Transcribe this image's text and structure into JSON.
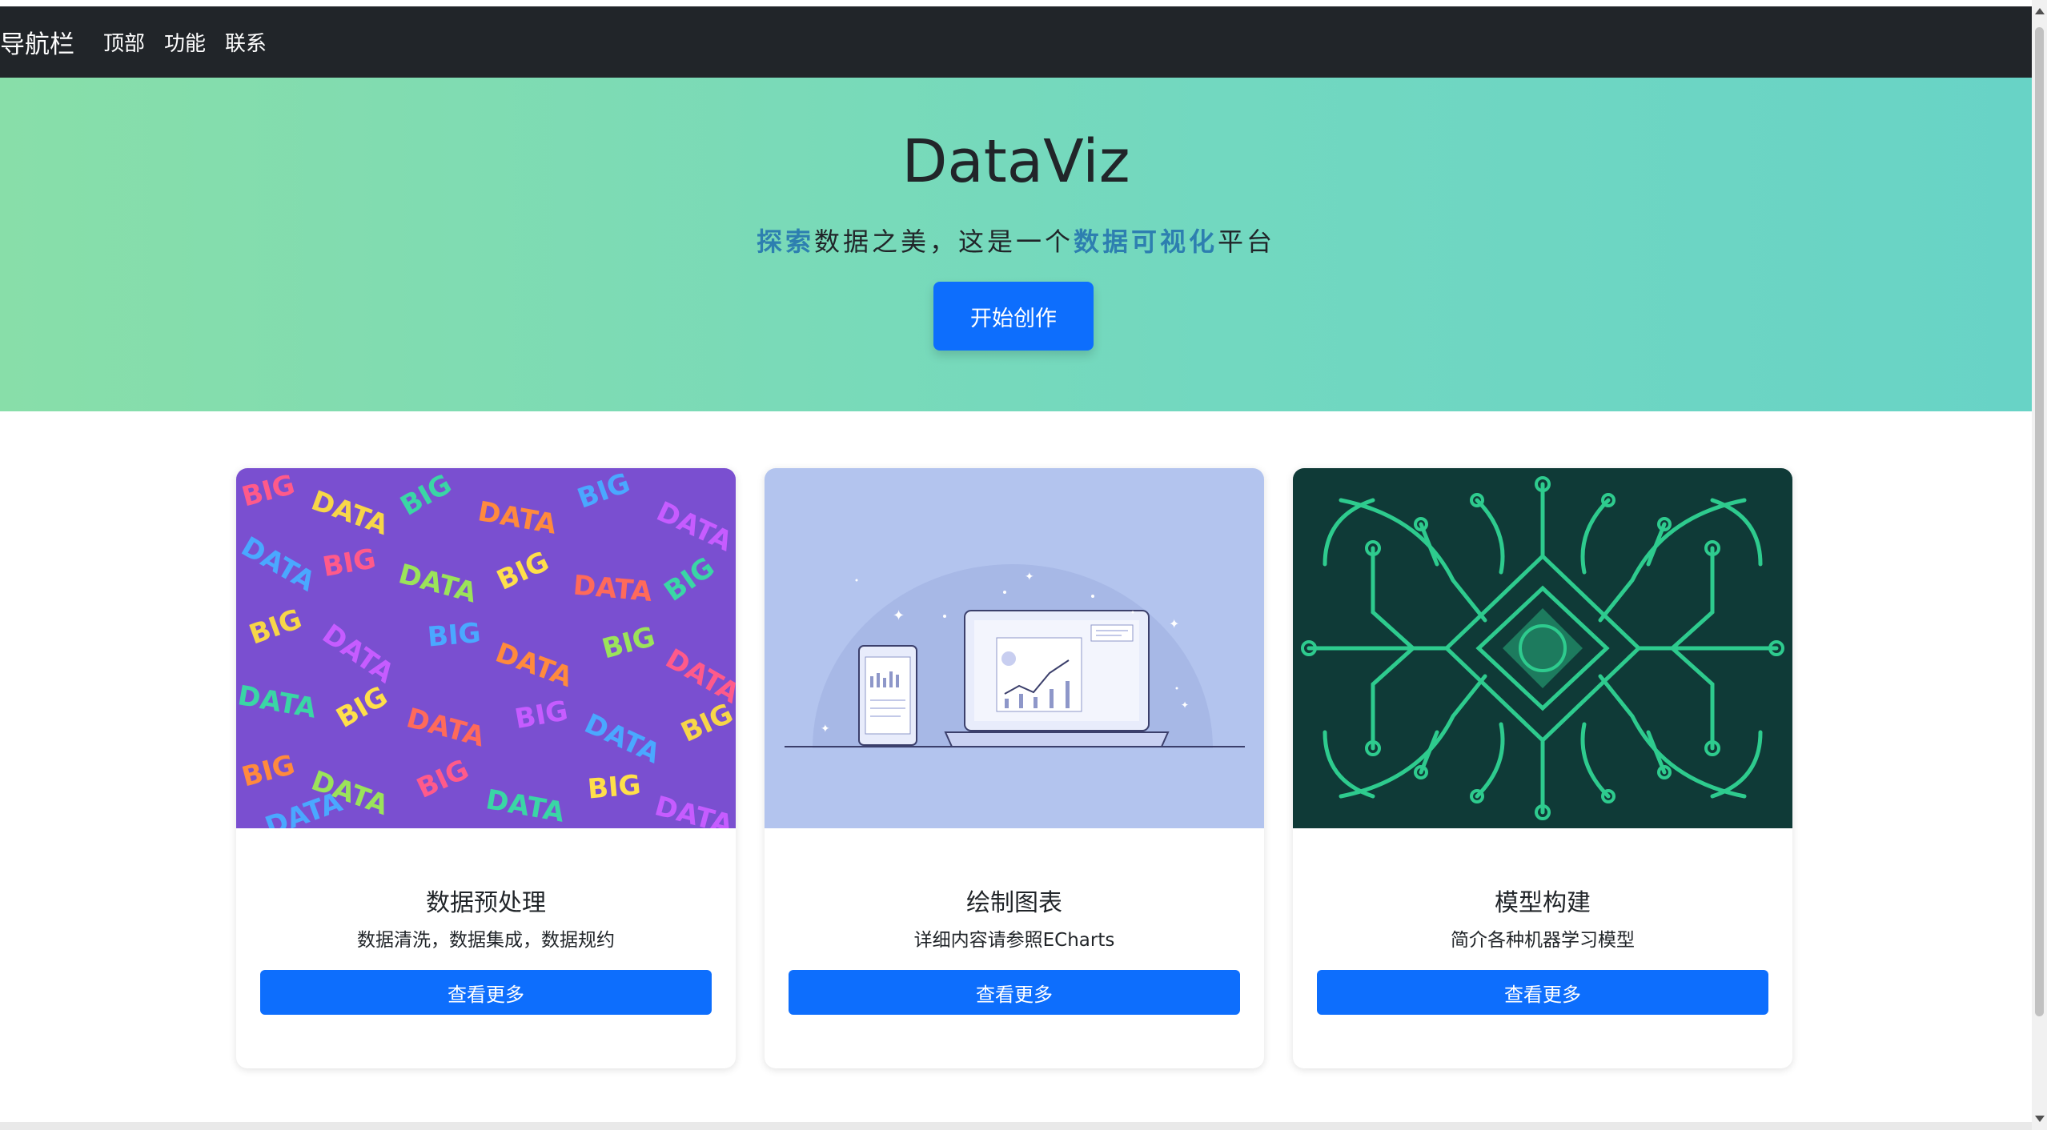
{
  "navbar": {
    "brand": "导航栏",
    "links": [
      "顶部",
      "功能",
      "联系"
    ]
  },
  "hero": {
    "title": "DataViz",
    "subtitle_parts": [
      "探索",
      "数据之美，这是一个",
      "数据可视化",
      "平台"
    ],
    "button": "开始创作"
  },
  "cards": [
    {
      "title": "数据预处理",
      "text": "数据清洗，数据集成，数据规约",
      "button": "查看更多",
      "image": "big-data-words-image"
    },
    {
      "title": "绘制图表",
      "text": "详细内容请参照ECharts",
      "button": "查看更多",
      "image": "laptop-chart-illustration"
    },
    {
      "title": "模型构建",
      "text": "简介各种机器学习模型",
      "button": "查看更多",
      "image": "circuit-pattern-image"
    }
  ],
  "colors": {
    "navbar_bg": "#212529",
    "primary": "#0d6efd",
    "hero_gradient_start": "#88dea9",
    "hero_gradient_end": "#68d3c6",
    "highlight": "#2d7fb0"
  }
}
